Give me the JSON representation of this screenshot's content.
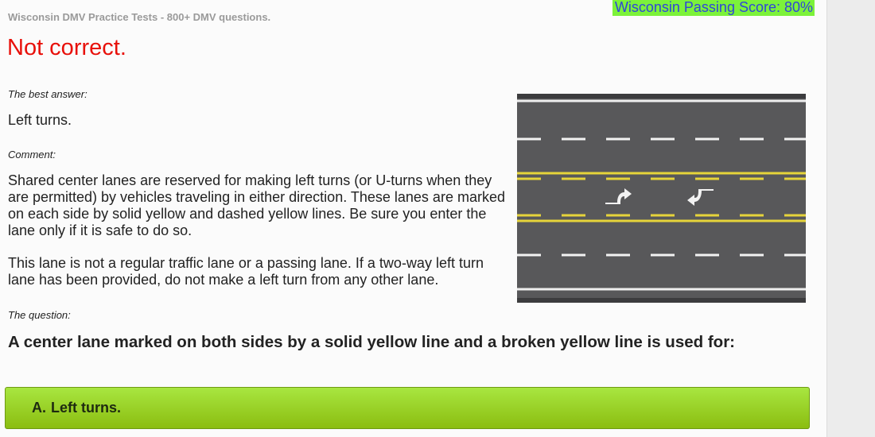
{
  "header": {
    "site_title": "Wisconsin DMV Practice Tests - 800+ DMV questions.",
    "passing_score": "Wisconsin Passing Score: 80%"
  },
  "result": {
    "status_text": "Not correct.",
    "status_color": "#e8100a"
  },
  "best_answer": {
    "label": "The best answer:",
    "text": "Left turns."
  },
  "comment": {
    "label": "Comment:",
    "paragraphs": [
      "Shared center lanes are reserved for making left turns (or U-turns when they are permitted) by vehicles traveling in either direction. These lanes are marked on each side by solid yellow and dashed yellow lines. Be sure you enter the lane only if it is safe to do so.",
      "This lane is not a regular traffic lane or a passing lane. If a two-way left turn lane has been provided, do not make a left turn from any other lane."
    ]
  },
  "illustration": {
    "icon": "two-way-left-turn-lane-road-diagram",
    "colors": {
      "asphalt": "#58585a",
      "yellow": "#e6d43a",
      "white": "#f2f2f2"
    }
  },
  "question": {
    "label": "The question:",
    "text": "A center lane marked on both sides by a solid yellow line and a broken yellow line is used for:"
  },
  "options": [
    {
      "letter": "A.",
      "text": "Left turns.",
      "state": "correct",
      "color": "#9ed52e"
    }
  ]
}
